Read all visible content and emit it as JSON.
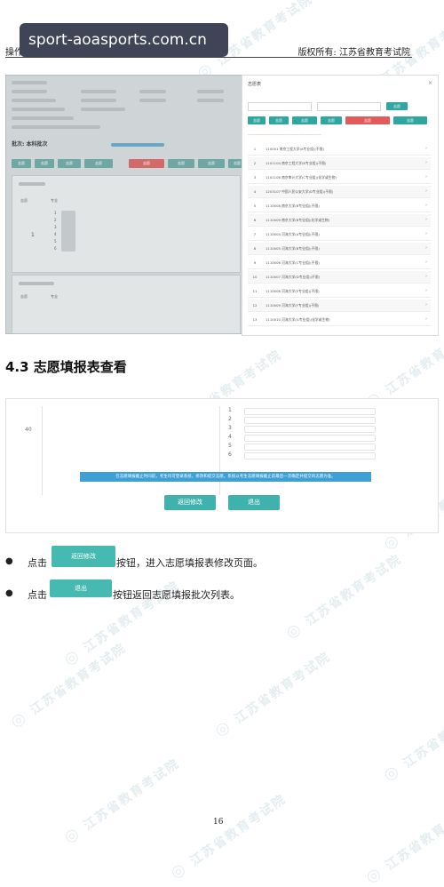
{
  "overlay": {
    "text": "sport-aoasports.com.cn"
  },
  "header": {
    "left": "操作手册",
    "right": "版权所有: 江苏省教育考试院"
  },
  "watermark": {
    "text": "江苏省教育考试院"
  },
  "screenshot1": {
    "batch_text": "批次: 本科批次",
    "buttons": [
      "志愿",
      "志愿",
      "志愿",
      "志愿",
      "志愿",
      "志愿",
      "志愿",
      "志愿"
    ],
    "list_nums": [
      "1",
      "2",
      "3",
      "4",
      "5",
      "6"
    ]
  },
  "modal": {
    "title": "志愿表",
    "buttons": [
      "志愿",
      "志愿",
      "志愿",
      "志愿",
      "志愿",
      "志愿"
    ],
    "rows": [
      {
        "n": "1",
        "t": "110001 南京工程大学(A专业组)(不限)"
      },
      {
        "n": "2",
        "t": "1101104 南京工程大学(B专业组)(不限)"
      },
      {
        "n": "3",
        "t": "1101106 南京审计大学(C专业组)(化学或生物)"
      },
      {
        "n": "4",
        "t": "1203107 中国人民公安大学(D专业组)(不限)"
      },
      {
        "n": "5",
        "t": "1110008 南京大学(B专业组)(不限)"
      },
      {
        "n": "6",
        "t": "1110009 南京大学(B专业组)(化学或生物)"
      },
      {
        "n": "7",
        "t": "1110004 河海大学(A专业组)(不限)"
      },
      {
        "n": "8",
        "t": "1110005 河海大学(B专业组)(不限)"
      },
      {
        "n": "9",
        "t": "1110006 河海大学(C专业组)(不限)"
      },
      {
        "n": "10",
        "t": "1110007 河海大学(D专业组)(不限)"
      },
      {
        "n": "11",
        "t": "1110008 河海大学(E专业组)(不限)"
      },
      {
        "n": "12",
        "t": "1110009 河海大学(F专业组)(不限)"
      },
      {
        "n": "13",
        "t": "1110010 河海大学(G专业组)(化学或生物)"
      }
    ]
  },
  "section": {
    "title": "4.3 志愿填报表查看"
  },
  "screenshot3": {
    "num": "40",
    "items": [
      "1",
      "2",
      "3",
      "4",
      "5",
      "6"
    ],
    "info": "在志愿填报截止时间前，考生均可登录系统，修改和提交志愿。系统以考生志愿填报截止前最后一次确定并提交的志愿为准。",
    "return_btn": "返回修改",
    "exit_btn": "退出"
  },
  "bullets": [
    {
      "prefix": "点击",
      "button": "返回修改",
      "suffix": "按钮，进入志愿填报表修改页面。"
    },
    {
      "prefix": "点击",
      "button": "退出",
      "suffix": "按钮返回志愿填报批次列表。"
    }
  ],
  "page": {
    "number": "16"
  }
}
